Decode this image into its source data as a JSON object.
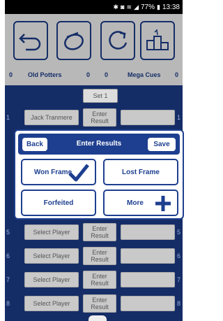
{
  "status_bar": {
    "battery": "77%",
    "time": "13:38"
  },
  "toolbar": {
    "icons": [
      "back-arrow-icon",
      "whistle-icon",
      "refresh-icon",
      "podium-icon"
    ]
  },
  "score": {
    "home_frames": "0",
    "home_team": "Old Potters",
    "home_score": "0",
    "away_score": "0",
    "away_team": "Mega Cues",
    "away_frames": "0"
  },
  "set_label": "Set 1",
  "rows": [
    {
      "num": "1",
      "player": "Jack Tranmere",
      "enter": "Enter Result"
    },
    {
      "num": "5",
      "player": "Select Player",
      "enter": "Enter Result"
    },
    {
      "num": "6",
      "player": "Select Player",
      "enter": "Enter Result"
    },
    {
      "num": "7",
      "player": "Select Player",
      "enter": "Enter Result"
    },
    {
      "num": "8",
      "player": "Select Player",
      "enter": "Enter Result"
    }
  ],
  "dialog": {
    "back": "Back",
    "title": "Enter Results",
    "save": "Save",
    "won": "Won Frame",
    "lost": "Lost Frame",
    "forfeited": "Forfeited",
    "more": "More"
  },
  "colors": {
    "primary": "#1e3f8f",
    "accent_check": "#1e3f8f"
  }
}
